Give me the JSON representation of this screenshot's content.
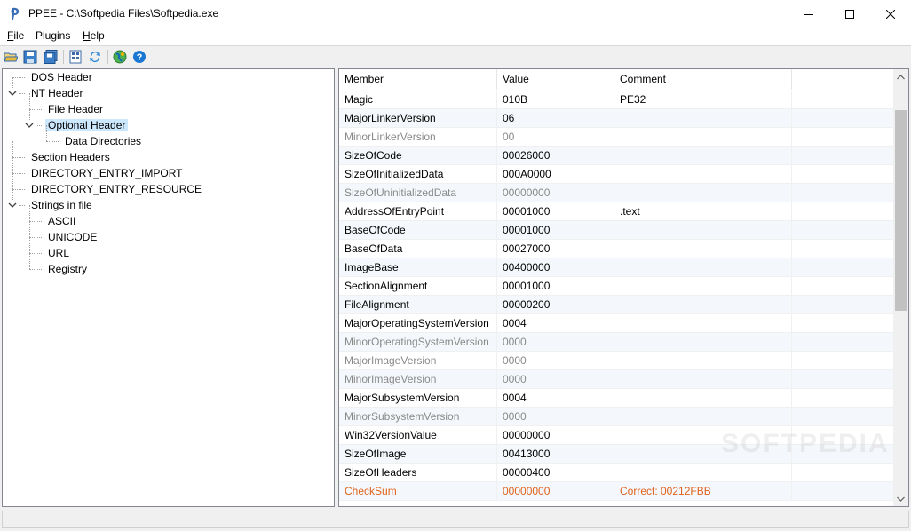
{
  "window": {
    "title": "PPEE - C:\\Softpedia Files\\Softpedia.exe",
    "icon": "ppee-app-icon"
  },
  "menu": [
    {
      "label": "File",
      "accel": "F",
      "rest": "ile"
    },
    {
      "label": "Plugins",
      "accel": "",
      "rest": "Plugins"
    },
    {
      "label": "Help",
      "accel": "H",
      "rest": "elp"
    }
  ],
  "toolbar": {
    "buttons": [
      "open-folder-icon",
      "save-icon",
      "save-all-icon",
      "hex-view-icon",
      "refresh-icon",
      "virustotal-icon",
      "help-icon"
    ]
  },
  "tree": {
    "items": [
      {
        "label": "DOS Header",
        "depth": 0,
        "expander": ""
      },
      {
        "label": "NT Header",
        "depth": 0,
        "expander": "expanded"
      },
      {
        "label": "File Header",
        "depth": 1,
        "expander": ""
      },
      {
        "label": "Optional Header",
        "depth": 1,
        "expander": "expanded",
        "selected": true
      },
      {
        "label": "Data Directories",
        "depth": 2,
        "expander": ""
      },
      {
        "label": "Section Headers",
        "depth": 0,
        "expander": ""
      },
      {
        "label": "DIRECTORY_ENTRY_IMPORT",
        "depth": 0,
        "expander": ""
      },
      {
        "label": "DIRECTORY_ENTRY_RESOURCE",
        "depth": 0,
        "expander": ""
      },
      {
        "label": "Strings in file",
        "depth": 0,
        "expander": "expanded"
      },
      {
        "label": "ASCII",
        "depth": 1,
        "expander": ""
      },
      {
        "label": "UNICODE",
        "depth": 1,
        "expander": ""
      },
      {
        "label": "URL",
        "depth": 1,
        "expander": ""
      },
      {
        "label": "Registry",
        "depth": 1,
        "expander": ""
      }
    ]
  },
  "list": {
    "columns": [
      "Member",
      "Value",
      "Comment"
    ],
    "rows": [
      {
        "member": "Magic",
        "value": "010B",
        "comment": "PE32",
        "state": "normal"
      },
      {
        "member": "MajorLinkerVersion",
        "value": "06",
        "comment": "",
        "state": "normal"
      },
      {
        "member": "MinorLinkerVersion",
        "value": "00",
        "comment": "",
        "state": "dim"
      },
      {
        "member": "SizeOfCode",
        "value": "00026000",
        "comment": "",
        "state": "normal"
      },
      {
        "member": "SizeOfInitializedData",
        "value": "000A0000",
        "comment": "",
        "state": "normal"
      },
      {
        "member": "SizeOfUninitializedData",
        "value": "00000000",
        "comment": "",
        "state": "dim"
      },
      {
        "member": "AddressOfEntryPoint",
        "value": "00001000",
        "comment": ".text",
        "state": "normal"
      },
      {
        "member": "BaseOfCode",
        "value": "00001000",
        "comment": "",
        "state": "normal"
      },
      {
        "member": "BaseOfData",
        "value": "00027000",
        "comment": "",
        "state": "normal"
      },
      {
        "member": "ImageBase",
        "value": "00400000",
        "comment": "",
        "state": "normal"
      },
      {
        "member": "SectionAlignment",
        "value": "00001000",
        "comment": "",
        "state": "normal"
      },
      {
        "member": "FileAlignment",
        "value": "00000200",
        "comment": "",
        "state": "normal"
      },
      {
        "member": "MajorOperatingSystemVersion",
        "value": "0004",
        "comment": "",
        "state": "normal"
      },
      {
        "member": "MinorOperatingSystemVersion",
        "value": "0000",
        "comment": "",
        "state": "dim"
      },
      {
        "member": "MajorImageVersion",
        "value": "0000",
        "comment": "",
        "state": "dim"
      },
      {
        "member": "MinorImageVersion",
        "value": "0000",
        "comment": "",
        "state": "dim"
      },
      {
        "member": "MajorSubsystemVersion",
        "value": "0004",
        "comment": "",
        "state": "normal"
      },
      {
        "member": "MinorSubsystemVersion",
        "value": "0000",
        "comment": "",
        "state": "dim"
      },
      {
        "member": "Win32VersionValue",
        "value": "00000000",
        "comment": "",
        "state": "normal"
      },
      {
        "member": "SizeOfImage",
        "value": "00413000",
        "comment": "",
        "state": "normal"
      },
      {
        "member": "SizeOfHeaders",
        "value": "00000400",
        "comment": "",
        "state": "normal"
      },
      {
        "member": "CheckSum",
        "value": "00000000",
        "comment": "Correct: 00212FBB",
        "state": "warn"
      }
    ],
    "scroll_position": 0.0
  },
  "watermark": "SOFTPEDIA",
  "colors": {
    "selection": "#cce8ff",
    "warning_text": "#e0621c",
    "dim_text": "#8a8a8a"
  }
}
